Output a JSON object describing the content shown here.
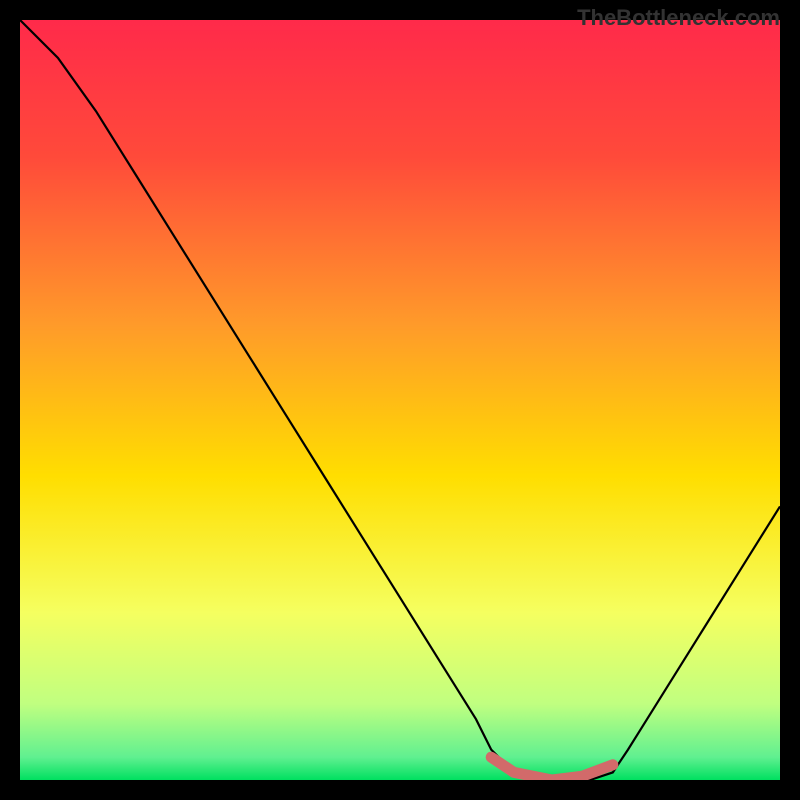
{
  "attribution": "TheBottleneck.com",
  "chart_data": {
    "type": "line",
    "title": "",
    "xlabel": "",
    "ylabel": "",
    "xlim": [
      0,
      100
    ],
    "ylim": [
      0,
      100
    ],
    "grid": false,
    "series": [
      {
        "name": "bottleneck-curve",
        "x": [
          0,
          5,
          10,
          15,
          20,
          25,
          30,
          35,
          40,
          45,
          50,
          55,
          60,
          62,
          65,
          70,
          75,
          78,
          80,
          85,
          90,
          95,
          100
        ],
        "y": [
          100,
          95,
          88,
          80,
          72,
          64,
          56,
          48,
          40,
          32,
          24,
          16,
          8,
          4,
          1,
          0,
          0,
          1,
          4,
          12,
          20,
          28,
          36
        ]
      },
      {
        "name": "optimal-band-marker",
        "x": [
          62,
          65,
          70,
          74,
          78
        ],
        "y": [
          3,
          1,
          0,
          0.5,
          2
        ]
      }
    ],
    "background_gradient": {
      "top": "#ff2a4a",
      "mid": "#ffde00",
      "bottom": "#00e060"
    },
    "marker_color": "#d26a6a"
  }
}
